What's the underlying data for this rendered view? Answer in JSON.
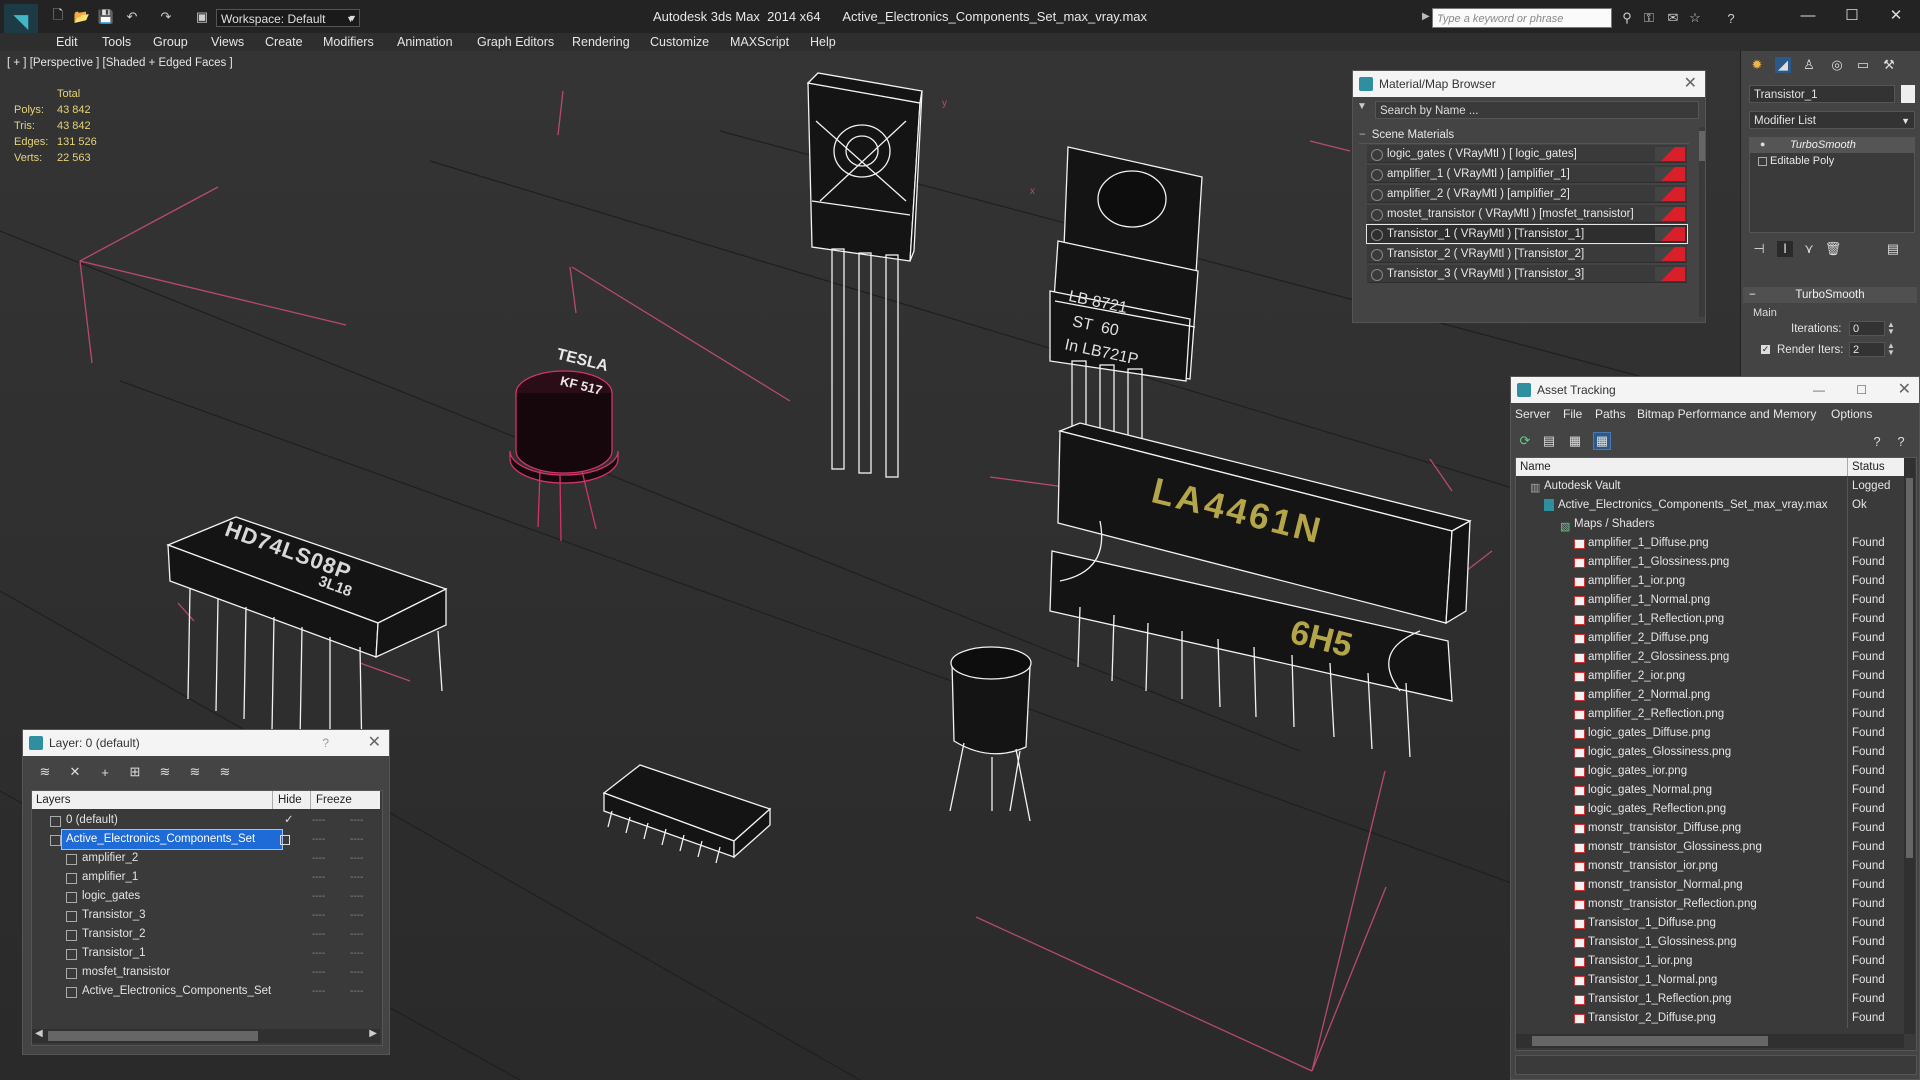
{
  "titlebar": {
    "workspace": "Workspace: Default",
    "app_name": "Autodesk 3ds Max  2014 x64",
    "file_name": "Active_Electronics_Components_Set_max_vray.max",
    "search_placeholder": "Type a keyword or phrase"
  },
  "menu": [
    "Edit",
    "Tools",
    "Group",
    "Views",
    "Create",
    "Modifiers",
    "Animation",
    "Graph Editors",
    "Rendering",
    "Customize",
    "MAXScript",
    "Help"
  ],
  "viewport": {
    "label": "[ + ] [Perspective ] [Shaded + Edged Faces ]",
    "stats": {
      "header": "Total",
      "rows": [
        {
          "label": "Polys:",
          "value": "43 842"
        },
        {
          "label": "Tris:",
          "value": "43 842"
        },
        {
          "label": "Edges:",
          "value": "131 526"
        },
        {
          "label": "Verts:",
          "value": "22 563"
        }
      ]
    },
    "part_text": [
      "TESLA",
      "KF 517",
      "HD74LS08P",
      "3L18",
      "LB 8721",
      "ST  60",
      "In LB721P",
      "LA4461N",
      "6H5"
    ],
    "axis_labels": [
      "y",
      "x"
    ]
  },
  "material_browser": {
    "title": "Material/Map Browser",
    "search_placeholder": "Search by Name ...",
    "section": "Scene Materials",
    "materials": [
      "logic_gates  ( VRayMtl ) [ logic_gates]",
      "amplifier_1  ( VRayMtl ) [amplifier_1]",
      "amplifier_2  ( VRayMtl ) [amplifier_2]",
      "mostet_transistor  ( VRayMtl ) [mosfet_transistor]",
      "Transistor_1  ( VRayMtl ) [Transistor_1]",
      "Transistor_2  ( VRayMtl ) [Transistor_2]",
      "Transistor_3  ( VRayMtl ) [Transistor_3]"
    ],
    "selected_index": 4
  },
  "command_panel": {
    "object_name": "Transistor_1",
    "modifier_list": "Modifier List",
    "stack": [
      "TurboSmooth",
      "Editable Poly"
    ],
    "rollout_title": "TurboSmooth",
    "group": "Main",
    "iterations_label": "Iterations:",
    "iterations_value": "0",
    "render_iters_label": "Render Iters:",
    "render_iters_value": "2"
  },
  "layer_panel": {
    "title": "Layer: 0 (default)",
    "help": "?",
    "columns": [
      "Layers",
      "Hide",
      "Freeze"
    ],
    "rows": [
      {
        "name": "0 (default)",
        "indent": 0,
        "selected": false,
        "current": true
      },
      {
        "name": "Active_Electronics_Components_Set",
        "indent": 0,
        "selected": true,
        "current": false
      },
      {
        "name": "amplifier_2",
        "indent": 1,
        "selected": false,
        "current": false
      },
      {
        "name": "amplifier_1",
        "indent": 1,
        "selected": false,
        "current": false
      },
      {
        "name": "logic_gates",
        "indent": 1,
        "selected": false,
        "current": false
      },
      {
        "name": "Transistor_3",
        "indent": 1,
        "selected": false,
        "current": false
      },
      {
        "name": "Transistor_2",
        "indent": 1,
        "selected": false,
        "current": false
      },
      {
        "name": "Transistor_1",
        "indent": 1,
        "selected": false,
        "current": false
      },
      {
        "name": "mosfet_transistor",
        "indent": 1,
        "selected": false,
        "current": false
      },
      {
        "name": "Active_Electronics_Components_Set",
        "indent": 1,
        "selected": false,
        "current": false
      }
    ]
  },
  "asset_tracking": {
    "title": "Asset Tracking",
    "menu": [
      "Server",
      "File",
      "Paths",
      "Bitmap Performance and Memory",
      "Options"
    ],
    "columns": [
      "Name",
      "Status"
    ],
    "rows": [
      {
        "name": "Autodesk Vault",
        "status": "Logged",
        "level": 0,
        "kind": "vault"
      },
      {
        "name": "Active_Electronics_Components_Set_max_vray.max",
        "status": "Ok",
        "level": 1,
        "kind": "max"
      },
      {
        "name": "Maps / Shaders",
        "status": "",
        "level": 2,
        "kind": "folder"
      },
      {
        "name": "amplifier_1_Diffuse.png",
        "status": "Found",
        "level": 3,
        "kind": "png"
      },
      {
        "name": "amplifier_1_Glossiness.png",
        "status": "Found",
        "level": 3,
        "kind": "png"
      },
      {
        "name": "amplifier_1_ior.png",
        "status": "Found",
        "level": 3,
        "kind": "png"
      },
      {
        "name": "amplifier_1_Normal.png",
        "status": "Found",
        "level": 3,
        "kind": "png"
      },
      {
        "name": "amplifier_1_Reflection.png",
        "status": "Found",
        "level": 3,
        "kind": "png"
      },
      {
        "name": "amplifier_2_Diffuse.png",
        "status": "Found",
        "level": 3,
        "kind": "png"
      },
      {
        "name": "amplifier_2_Glossiness.png",
        "status": "Found",
        "level": 3,
        "kind": "png"
      },
      {
        "name": "amplifier_2_ior.png",
        "status": "Found",
        "level": 3,
        "kind": "png"
      },
      {
        "name": "amplifier_2_Normal.png",
        "status": "Found",
        "level": 3,
        "kind": "png"
      },
      {
        "name": "amplifier_2_Reflection.png",
        "status": "Found",
        "level": 3,
        "kind": "png"
      },
      {
        "name": "logic_gates_Diffuse.png",
        "status": "Found",
        "level": 3,
        "kind": "png"
      },
      {
        "name": "logic_gates_Glossiness.png",
        "status": "Found",
        "level": 3,
        "kind": "png"
      },
      {
        "name": "logic_gates_ior.png",
        "status": "Found",
        "level": 3,
        "kind": "png"
      },
      {
        "name": "logic_gates_Normal.png",
        "status": "Found",
        "level": 3,
        "kind": "png"
      },
      {
        "name": "logic_gates_Reflection.png",
        "status": "Found",
        "level": 3,
        "kind": "png"
      },
      {
        "name": "monstr_transistor_Diffuse.png",
        "status": "Found",
        "level": 3,
        "kind": "png"
      },
      {
        "name": "monstr_transistor_Glossiness.png",
        "status": "Found",
        "level": 3,
        "kind": "png"
      },
      {
        "name": "monstr_transistor_ior.png",
        "status": "Found",
        "level": 3,
        "kind": "png"
      },
      {
        "name": "monstr_transistor_Normal.png",
        "status": "Found",
        "level": 3,
        "kind": "png"
      },
      {
        "name": "monstr_transistor_Reflection.png",
        "status": "Found",
        "level": 3,
        "kind": "png"
      },
      {
        "name": "Transistor_1_Diffuse.png",
        "status": "Found",
        "level": 3,
        "kind": "png"
      },
      {
        "name": "Transistor_1_Glossiness.png",
        "status": "Found",
        "level": 3,
        "kind": "png"
      },
      {
        "name": "Transistor_1_ior.png",
        "status": "Found",
        "level": 3,
        "kind": "png"
      },
      {
        "name": "Transistor_1_Normal.png",
        "status": "Found",
        "level": 3,
        "kind": "png"
      },
      {
        "name": "Transistor_1_Reflection.png",
        "status": "Found",
        "level": 3,
        "kind": "png"
      },
      {
        "name": "Transistor_2_Diffuse.png",
        "status": "Found",
        "level": 3,
        "kind": "png"
      }
    ]
  },
  "colors": {
    "accent_selection": "#1e6ad6",
    "material_swatch": "#d9202a",
    "stats_text": "#e4d37a",
    "wire_pink": "#c8245c",
    "grid_red": "#b84a6a"
  }
}
